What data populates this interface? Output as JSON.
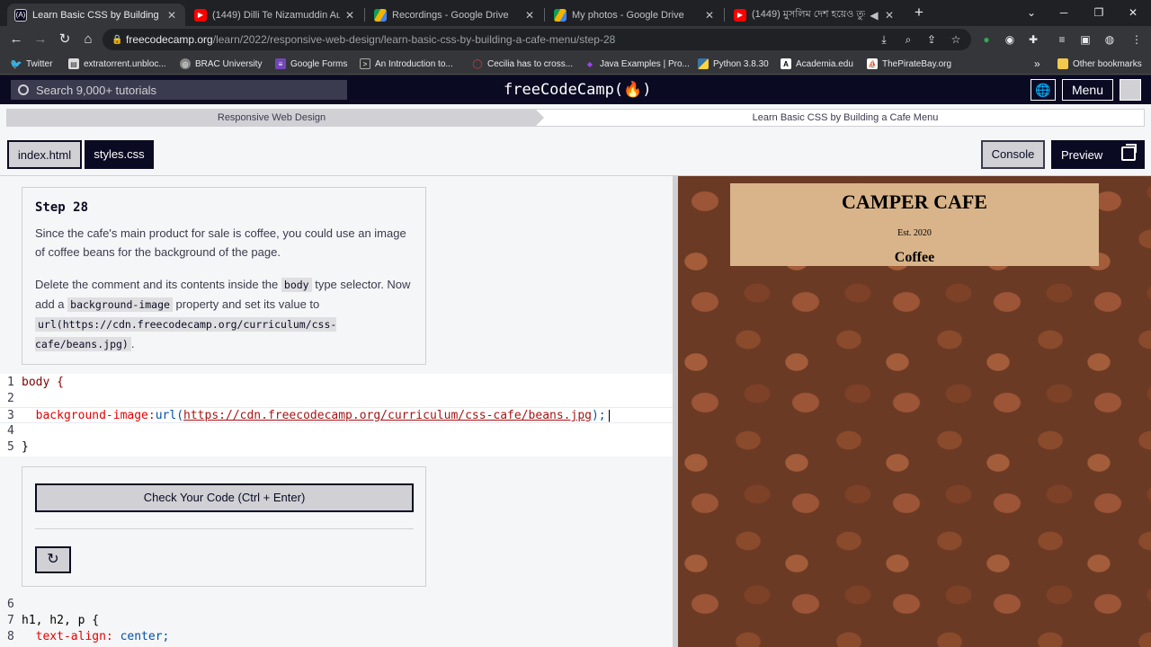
{
  "browser": {
    "tabs": [
      {
        "title": "Learn Basic CSS by Building a Ca...",
        "icon": "freecodecamp-icon"
      },
      {
        "title": "(1449) Dilli Te Nizamuddin Aulia",
        "icon": "youtube-icon"
      },
      {
        "title": "Recordings - Google Drive",
        "icon": "google-drive-icon"
      },
      {
        "title": "My photos - Google Drive",
        "icon": "google-drive-icon"
      },
      {
        "title": "(1449) মুসলিম দেশ হয়েও তুর",
        "icon": "youtube-icon"
      }
    ],
    "url_host": "freecodecamp.org",
    "url_path": "/learn/2022/responsive-web-design/learn-basic-css-by-building-a-cafe-menu/step-28",
    "bookmarks": [
      "Twitter",
      "extratorrent.unbloc...",
      "BRAC University",
      "Google Forms",
      "An Introduction to...",
      "Cecilia has to cross...",
      "Java Examples | Pro...",
      "Python 3.8.30",
      "Academia.edu",
      "ThePirateBay.org"
    ],
    "other_bookmarks": "Other bookmarks",
    "more_bookmarks": "»"
  },
  "fcc": {
    "search_placeholder": "Search 9,000+ tutorials",
    "logo": "freeCodeCamp(🔥)",
    "menu_label": "Menu",
    "breadcrumb_1": "Responsive Web Design",
    "breadcrumb_2": "Learn Basic CSS by Building a Cafe Menu",
    "file_tab_1": "index.html",
    "file_tab_2": "styles.css",
    "console_label": "Console",
    "preview_label": "Preview"
  },
  "instructions": {
    "step": "Step 28",
    "p1": "Since the cafe's main product for sale is coffee, you could use an image of coffee beans for the background of the page.",
    "p2_a": "Delete the comment and its contents inside the ",
    "p2_code1": "body",
    "p2_b": " type selector. Now add a ",
    "p2_code2": "background-image",
    "p2_c": " property and set its value to ",
    "p2_code3": "url(https://cdn.freecodecamp.org/curriculum/css-cafe/beans.jpg)",
    "p2_d": "."
  },
  "code": {
    "line1_num": "1",
    "line1": "body {",
    "line2_num": "2",
    "line3_num": "3",
    "line3_prop": "  background-image:",
    "line3_fn": "url(",
    "line3_url": "https://cdn.freecodecamp.org/curriculum/css-cafe/beans.jpg",
    "line3_end": ");",
    "line4_num": "4",
    "line5_num": "5",
    "line5": "}",
    "line6_num": "6",
    "line7_num": "7",
    "line7": "h1, h2, p {",
    "line8_num": "8",
    "line8_prop": "  text-align:",
    "line8_val": " center;"
  },
  "check": {
    "button": "Check Your Code (Ctrl + Enter)",
    "reset_icon": "↻"
  },
  "preview": {
    "title": "CAMPER CAFE",
    "est": "Est. 2020",
    "section": "Coffee"
  }
}
